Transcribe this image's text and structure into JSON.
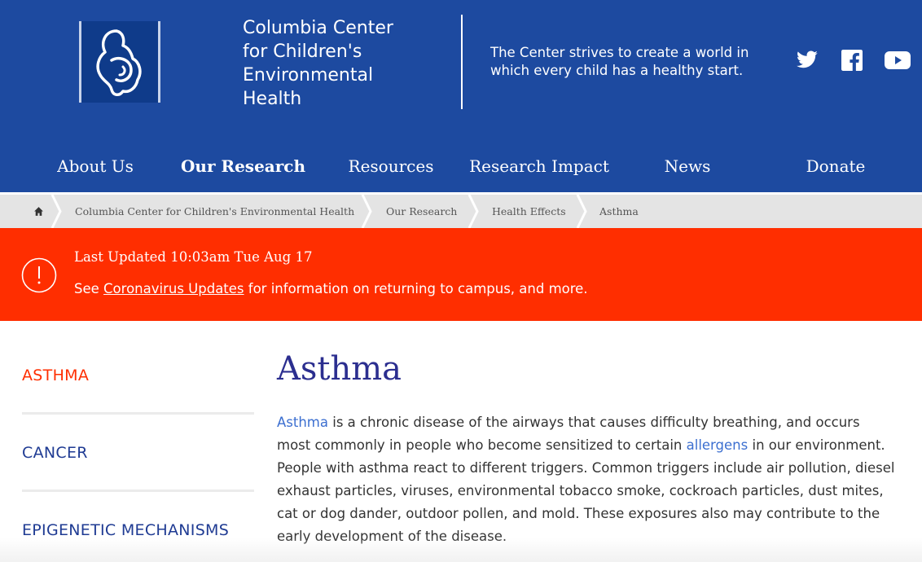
{
  "header": {
    "title": "Columbia Center for Children's Environmental Health",
    "tagline": "The Center strives to create a world in which every child has a healthy start.",
    "social": [
      {
        "name": "twitter-icon"
      },
      {
        "name": "facebook-icon"
      },
      {
        "name": "youtube-icon"
      }
    ]
  },
  "nav": {
    "items": [
      {
        "label": "About Us"
      },
      {
        "label": "Our Research"
      },
      {
        "label": "Resources"
      },
      {
        "label": "Research Impact"
      },
      {
        "label": "News"
      },
      {
        "label": "Donate"
      }
    ],
    "active": "Our Research"
  },
  "breadcrumb": {
    "items": [
      {
        "label": "Columbia Center for Children's Environmental Health"
      },
      {
        "label": "Our Research"
      },
      {
        "label": "Health Effects"
      },
      {
        "label": "Asthma"
      }
    ]
  },
  "alert": {
    "updated": "Last Updated 10:03am Tue Aug 17",
    "prefix": "See",
    "link": "Coronavirus Updates",
    "suffix": "for information on returning to campus, and more."
  },
  "sidebar": {
    "items": [
      {
        "label": "ASTHMA"
      },
      {
        "label": "CANCER"
      },
      {
        "label": "EPIGENETIC MECHANISMS"
      }
    ]
  },
  "main": {
    "title": "Asthma",
    "link1": "Asthma",
    "text1": "is a chronic disease of the airways that causes difficulty breathing, and occurs most commonly in people who become sensitized to certain",
    "link2": "allergens",
    "text2": "in our environment.  People with asthma react to different triggers. Common triggers include air pollution, diesel exhaust particles, viruses, environmental tobacco smoke, cockroach particles, dust mites, cat or dog dander, outdoor pollen, and mold. These exposures also may contribute to the early development of the disease."
  },
  "colors": {
    "header_bg": "#1d4aa0",
    "alert_bg": "#ff2e00",
    "title": "#2b2e8f",
    "link": "#3c6fd0"
  }
}
